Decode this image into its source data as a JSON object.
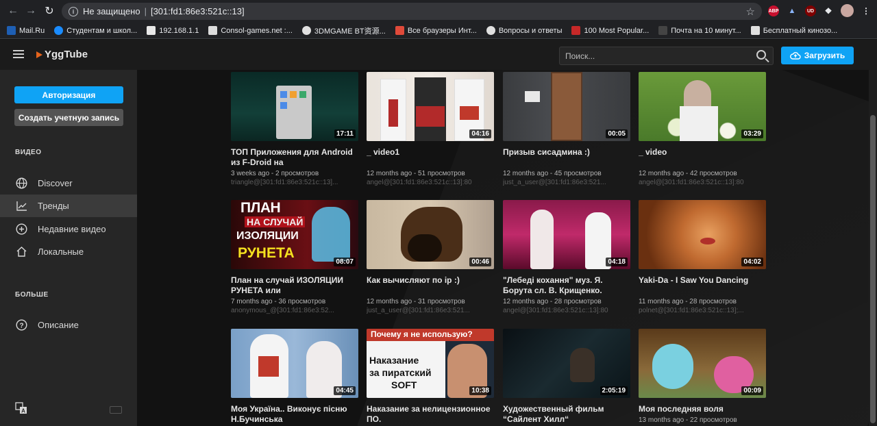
{
  "browser": {
    "security_label": "Не защищено",
    "url": "[301:fd1:86e3:521c::13]",
    "extensions": [
      "ABP",
      "UD"
    ]
  },
  "bookmarks": [
    {
      "label": "Mail.Ru",
      "color": "#1e5fb4"
    },
    {
      "label": "Студентам и школ...",
      "color": "#1a8cff"
    },
    {
      "label": "192.168.1.1",
      "color": "#e8e8e8"
    },
    {
      "label": "Consol-games.net :...",
      "color": "#dcdcdc"
    },
    {
      "label": "3DMGAME BT资源...",
      "color": "#e0e0e0"
    },
    {
      "label": "Все браузеры Инт...",
      "color": "#e04a3a"
    },
    {
      "label": "Вопросы и ответы",
      "color": "#e0e0e0"
    },
    {
      "label": "100 Most Popular...",
      "color": "#c62828"
    },
    {
      "label": "Почта на 10 минут...",
      "color": "#444444"
    },
    {
      "label": "Бесплатный кинозо...",
      "color": "#e0e0e0"
    }
  ],
  "header": {
    "logo_text": "YggTube",
    "search_placeholder": "Поиск...",
    "upload_label": "Загрузить"
  },
  "sidebar": {
    "login_label": "Авторизация",
    "signup_label": "Создать учетную запись",
    "video_section": "ВИДЕО",
    "items": [
      {
        "label": "Discover",
        "icon": "globe-icon"
      },
      {
        "label": "Тренды",
        "icon": "trending-icon"
      },
      {
        "label": "Недавние видео",
        "icon": "plus-circle-icon"
      },
      {
        "label": "Локальные",
        "icon": "home-icon"
      }
    ],
    "more_section": "БОЛЬШЕ",
    "about_label": "Описание"
  },
  "videos": [
    {
      "title": "ТОП Приложения для Android из F-Droid на",
      "duration": "17:11",
      "meta": "3 weeks ago - 2 просмотров",
      "account": "triangle@[301:fd1:86e3:521c::13]..."
    },
    {
      "title": "_ video1",
      "duration": "04:16",
      "meta": "12 months ago - 51 просмотров",
      "account": "angel@[301:fd1:86e3:521c::13]:80"
    },
    {
      "title": "Призыв сисадмина :)",
      "duration": "00:05",
      "meta": "12 months ago - 45 просмотров",
      "account": "just_a_user@[301:fd1:86e3:521..."
    },
    {
      "title": "_ video",
      "duration": "03:29",
      "meta": "12 months ago - 42 просмотров",
      "account": "angel@[301:fd1:86e3:521c::13]:80"
    },
    {
      "title": "План на случай ИЗОЛЯЦИИ РУНЕТА или",
      "duration": "08:07",
      "meta": "7 months ago - 36 просмотров",
      "account": "anonymous_@[301:fd1:86e3:52..."
    },
    {
      "title": "Как вычисляют по ip :)",
      "duration": "00:46",
      "meta": "12 months ago - 31 просмотров",
      "account": "just_a_user@[301:fd1:86e3:521..."
    },
    {
      "title": "\"Лебеді кохання\" муз. Я. Борута сл. В. Крищенко.",
      "duration": "04:18",
      "meta": "12 months ago - 28 просмотров",
      "account": "angel@[301:fd1:86e3:521c::13]:80"
    },
    {
      "title": "Yaki-Da - I Saw You Dancing",
      "duration": "04:02",
      "meta": "11 months ago - 28 просмотров",
      "account": "polnet@[301:fd1:86e3:521c::13];..."
    },
    {
      "title": "Моя Україна.. Виконує пісню Н.Бучинська",
      "duration": "04:45",
      "meta": "",
      "account": ""
    },
    {
      "title": "Наказание за нелицензионное ПО.",
      "duration": "10:38",
      "meta": "",
      "account": ""
    },
    {
      "title": "Художественный фильм “Сайлент Хилл“",
      "duration": "2:05:19",
      "meta": "",
      "account": ""
    },
    {
      "title": "Моя последняя воля",
      "duration": "00:09",
      "meta": "13 months ago - 22 просмотров",
      "account": ""
    }
  ],
  "thumb_text": {
    "plan_line1": "ПЛАН",
    "plan_line2": "НА СЛУЧАЙ",
    "plan_line3": "ИЗОЛЯЦИИ",
    "plan_line4": "РУНЕТА",
    "soft_banner": "Почему я не использую?",
    "soft_line1": "Наказание",
    "soft_line2": "за пиратский",
    "soft_line3": "SOFT"
  }
}
